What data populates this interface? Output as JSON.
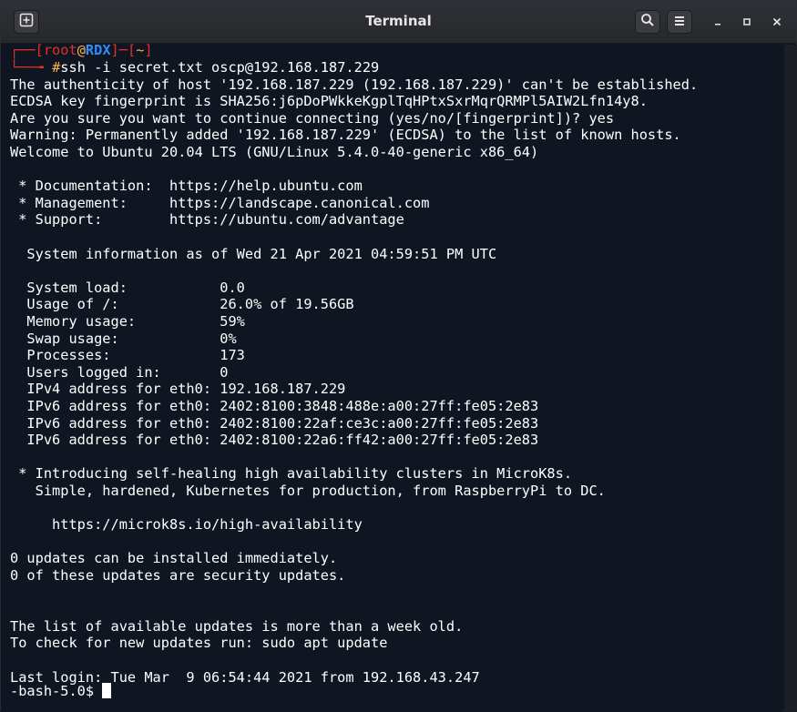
{
  "window": {
    "title": "Terminal"
  },
  "icons": {
    "new_tab": "new-tab-icon",
    "search": "search-icon",
    "menu": "hamburger-menu-icon",
    "minimize": "minimize-icon",
    "maximize": "maximize-icon",
    "close": "close-icon"
  },
  "colors": {
    "terminal_bg": "#0f1622",
    "prompt_red": "#e0312b",
    "prompt_host_blue": "#2f8cff",
    "prompt_hash_orange": "#ffb34d",
    "titlebar": "#2f3136"
  },
  "prompt": {
    "bracket_open": "┌──[",
    "user": "root",
    "at": "@",
    "host": "RDX",
    "mid": "]─[",
    "dir": "~",
    "bracket_close": "]",
    "arrow": "└──╼ ",
    "hash": "#",
    "command": "ssh -i secret.txt oscp@192.168.187.229"
  },
  "output": [
    "The authenticity of host '192.168.187.229 (192.168.187.229)' can't be established.",
    "ECDSA key fingerprint is SHA256:j6pDoPWkkeKgplTqHPtxSxrMqrQRMPl5AIW2Lfn14y8.",
    "Are you sure you want to continue connecting (yes/no/[fingerprint])? yes",
    "Warning: Permanently added '192.168.187.229' (ECDSA) to the list of known hosts.",
    "Welcome to Ubuntu 20.04 LTS (GNU/Linux 5.4.0-40-generic x86_64)",
    "",
    " * Documentation:  https://help.ubuntu.com",
    " * Management:     https://landscape.canonical.com",
    " * Support:        https://ubuntu.com/advantage",
    "",
    "  System information as of Wed 21 Apr 2021 04:59:51 PM UTC",
    "",
    "  System load:           0.0",
    "  Usage of /:            26.0% of 19.56GB",
    "  Memory usage:          59%",
    "  Swap usage:            0%",
    "  Processes:             173",
    "  Users logged in:       0",
    "  IPv4 address for eth0: 192.168.187.229",
    "  IPv6 address for eth0: 2402:8100:3848:488e:a00:27ff:fe05:2e83",
    "  IPv6 address for eth0: 2402:8100:22af:ce3c:a00:27ff:fe05:2e83",
    "  IPv6 address for eth0: 2402:8100:22a6:ff42:a00:27ff:fe05:2e83",
    "",
    " * Introducing self-healing high availability clusters in MicroK8s.",
    "   Simple, hardened, Kubernetes for production, from RaspberryPi to DC.",
    "",
    "     https://microk8s.io/high-availability",
    "",
    "0 updates can be installed immediately.",
    "0 of these updates are security updates.",
    "",
    "",
    "The list of available updates is more than a week old.",
    "To check for new updates run: sudo apt update",
    "",
    "Last login: Tue Mar  9 06:54:44 2021 from 192.168.43.247"
  ],
  "final_prompt": "-bash-5.0$ "
}
